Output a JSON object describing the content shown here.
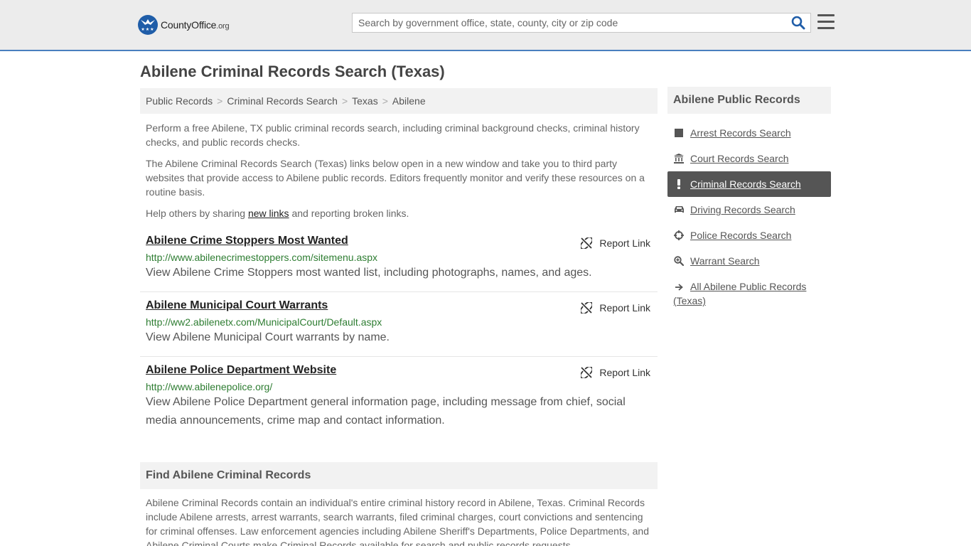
{
  "header": {
    "logo_name": "CountyOffice",
    "logo_tld": ".org",
    "search_placeholder": "Search by government office, state, county, city or zip code"
  },
  "page": {
    "title": "Abilene Criminal Records Search (Texas)"
  },
  "breadcrumb": [
    "Public Records",
    "Criminal Records Search",
    "Texas",
    "Abilene"
  ],
  "intro": {
    "p1": "Perform a free Abilene, TX public criminal records search, including criminal background checks, criminal history checks, and public records checks.",
    "p2": "The Abilene Criminal Records Search (Texas) links below open in a new window and take you to third party websites that provide access to Abilene public records. Editors frequently monitor and verify these resources on a routine basis.",
    "p3_before": "Help others by sharing ",
    "p3_link": "new links",
    "p3_after": " and reporting broken links."
  },
  "records": [
    {
      "title": "Abilene Crime Stoppers Most Wanted",
      "url": "http://www.abilenecrimestoppers.com/sitemenu.aspx",
      "desc": "View Abilene Crime Stoppers most wanted list, including photographs, names, and ages.",
      "report": "Report Link"
    },
    {
      "title": "Abilene Municipal Court Warrants",
      "url": "http://ww2.abilenetx.com/MunicipalCourt/Default.aspx",
      "desc": "View Abilene Municipal Court warrants by name.",
      "report": "Report Link"
    },
    {
      "title": "Abilene Police Department Website",
      "url": "http://www.abilenepolice.org/",
      "desc": "View Abilene Police Department general information page, including message from chief, social media announcements, crime map and contact information.",
      "report": "Report Link"
    }
  ],
  "find": {
    "title": "Find Abilene Criminal Records",
    "text": "Abilene Criminal Records contain an individual's entire criminal history record in Abilene, Texas. Criminal Records include Abilene arrests, arrest warrants, search warrants, filed criminal charges, court convictions and sentencing for criminal offenses. Law enforcement agencies including Abilene Sheriff's Departments, Police Departments, and Abilene Criminal Courts make Criminal Records available for search and public records requests."
  },
  "sidebar": {
    "title": "Abilene Public Records",
    "items": [
      {
        "label": "Arrest Records Search",
        "icon": "square-icon"
      },
      {
        "label": "Court Records Search",
        "icon": "courthouse-icon"
      },
      {
        "label": "Criminal Records Search",
        "icon": "exclamation-icon",
        "active": true
      },
      {
        "label": "Driving Records Search",
        "icon": "car-icon"
      },
      {
        "label": "Police Records Search",
        "icon": "crosshair-icon"
      },
      {
        "label": "Warrant Search",
        "icon": "search-plus-icon"
      },
      {
        "label": "All Abilene Public Records (Texas)",
        "icon": "arrow-right-icon"
      }
    ]
  },
  "colors": {
    "accent": "#4a7fbf",
    "active_bg": "#555555",
    "url_green": "#2e7d32"
  }
}
